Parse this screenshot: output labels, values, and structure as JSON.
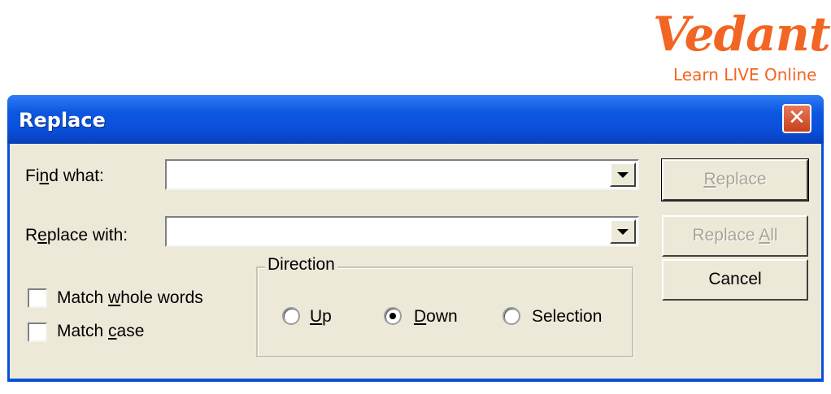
{
  "logo": {
    "wordmark": "Vedantu",
    "tagline": "Learn LIVE Online"
  },
  "window": {
    "title": "Replace",
    "close_label": "✕"
  },
  "find_what": {
    "label": "Find what:",
    "value": "",
    "placeholder": ""
  },
  "replace_with": {
    "label": "Replace with:",
    "value": "",
    "placeholder": ""
  },
  "options": {
    "match_whole_words": {
      "label": "Match whole words",
      "checked": false
    },
    "match_case": {
      "label": "Match case",
      "checked": false
    }
  },
  "direction": {
    "legend": "Direction",
    "options": [
      {
        "label": "Up",
        "selected": false
      },
      {
        "label": "Down",
        "selected": true
      },
      {
        "label": "Selection",
        "selected": false
      }
    ]
  },
  "buttons": {
    "replace": "Replace",
    "replace_all": "Replace All",
    "cancel": "Cancel"
  },
  "colors": {
    "titlebar": "#0a4fdc",
    "dialog_bg": "#ece9d8",
    "close_button": "#d4502a",
    "logo": "#f26522",
    "disabled_text": "#a7a596"
  }
}
